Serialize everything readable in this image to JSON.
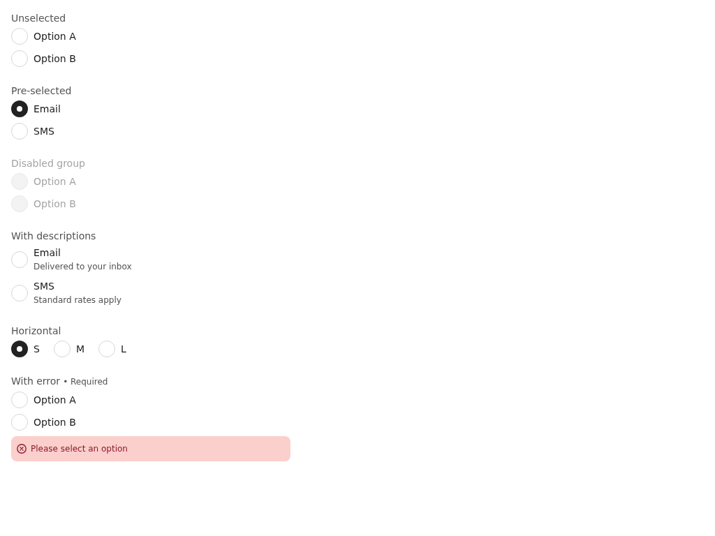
{
  "groups": [
    {
      "label": "Unselected",
      "kind": "vertical",
      "disabled": false,
      "options": [
        {
          "label": "Option A",
          "selected": false
        },
        {
          "label": "Option B",
          "selected": false
        }
      ]
    },
    {
      "label": "Pre-selected",
      "kind": "vertical",
      "disabled": false,
      "options": [
        {
          "label": "Email",
          "selected": true
        },
        {
          "label": "SMS",
          "selected": false
        }
      ]
    },
    {
      "label": "Disabled group",
      "kind": "vertical",
      "disabled": true,
      "options": [
        {
          "label": "Option A",
          "selected": false
        },
        {
          "label": "Option B",
          "selected": false
        }
      ]
    },
    {
      "label": "With descriptions",
      "kind": "vertical",
      "disabled": false,
      "options": [
        {
          "label": "Email",
          "description": "Delivered to your inbox",
          "selected": false
        },
        {
          "label": "SMS",
          "description": "Standard rates apply",
          "selected": false
        }
      ]
    },
    {
      "label": "Horizontal",
      "kind": "horizontal",
      "disabled": false,
      "options": [
        {
          "label": "S",
          "selected": true
        },
        {
          "label": "M",
          "selected": false
        },
        {
          "label": "L",
          "selected": false
        }
      ]
    },
    {
      "label": "With error",
      "note": "• Required",
      "kind": "vertical",
      "disabled": false,
      "options": [
        {
          "label": "Option A",
          "selected": false
        },
        {
          "label": "Option B",
          "selected": false
        }
      ],
      "error": {
        "message": "Please select an option"
      }
    }
  ]
}
